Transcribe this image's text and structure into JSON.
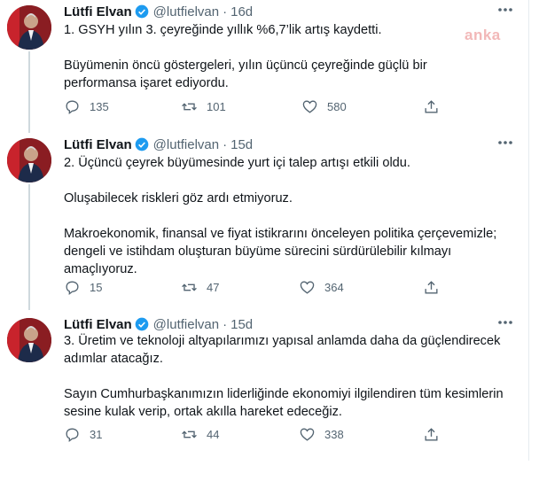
{
  "watermark": "anka",
  "tweets": [
    {
      "name": "Lütfi Elvan",
      "handle": "@lutfielvan",
      "sep": "·",
      "time": "16d",
      "paragraphs": [
        "1. GSYH yılın 3. çeyreğinde yıllık %6,7’lik artış kaydetti.",
        "Büyümenin öncü göstergeleri, yılın üçüncü çeyreğinde güçlü bir performansa işaret ediyordu."
      ],
      "replies": "135",
      "retweets": "101",
      "likes": "580"
    },
    {
      "name": "Lütfi Elvan",
      "handle": "@lutfielvan",
      "sep": "·",
      "time": "15d",
      "paragraphs": [
        "2. Üçüncü çeyrek büyümesinde yurt içi talep artışı etkili oldu.",
        "Oluşabilecek riskleri göz ardı etmiyoruz.",
        "Makroekonomik, finansal ve fiyat istikrarını önceleyen politika çerçevemizle; dengeli ve istihdam oluşturan büyüme sürecini sürdürülebilir kılmayı amaçlıyoruz."
      ],
      "replies": "15",
      "retweets": "47",
      "likes": "364"
    },
    {
      "name": "Lütfi Elvan",
      "handle": "@lutfielvan",
      "sep": "·",
      "time": "15d",
      "paragraphs": [
        "3. Üretim ve teknoloji altyapılarımızı yapısal anlamda daha da güçlendirecek adımlar atacağız.",
        "Sayın Cumhurbaşkanımızın liderliğinde ekonomiyi ilgilendiren tüm kesimlerin sesine kulak verip, ortak akılla hareket edeceğiz."
      ],
      "replies": "31",
      "retweets": "44",
      "likes": "338"
    }
  ]
}
